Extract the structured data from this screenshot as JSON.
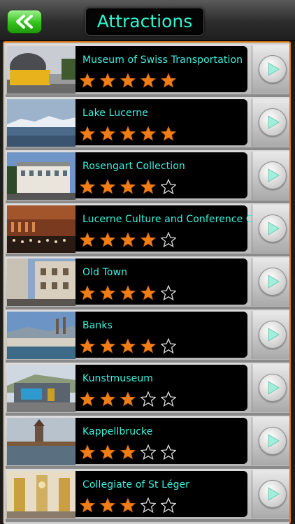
{
  "header": {
    "title": "Attractions",
    "back_icon": "double-chevron-left-icon",
    "back_color": "#35c21b",
    "title_color": "#2ef5d0"
  },
  "list": {
    "accent": "#e07b1a",
    "star_color": "#f07d16",
    "items": [
      {
        "name": "Museum of Swiss Transportation",
        "rating": 5,
        "max": 5
      },
      {
        "name": "Lake Lucerne",
        "rating": 5,
        "max": 5
      },
      {
        "name": "Rosengart Collection",
        "rating": 4,
        "max": 5
      },
      {
        "name": "Lucerne Culture and Conference Centre",
        "rating": 4,
        "max": 5
      },
      {
        "name": "Old Town",
        "rating": 4,
        "max": 5
      },
      {
        "name": "Banks",
        "rating": 4,
        "max": 5
      },
      {
        "name": "Kunstmuseum",
        "rating": 3,
        "max": 5
      },
      {
        "name": "Kappellbrucke",
        "rating": 3,
        "max": 5
      },
      {
        "name": "Collegiate of St Léger",
        "rating": 3,
        "max": 5
      }
    ]
  }
}
